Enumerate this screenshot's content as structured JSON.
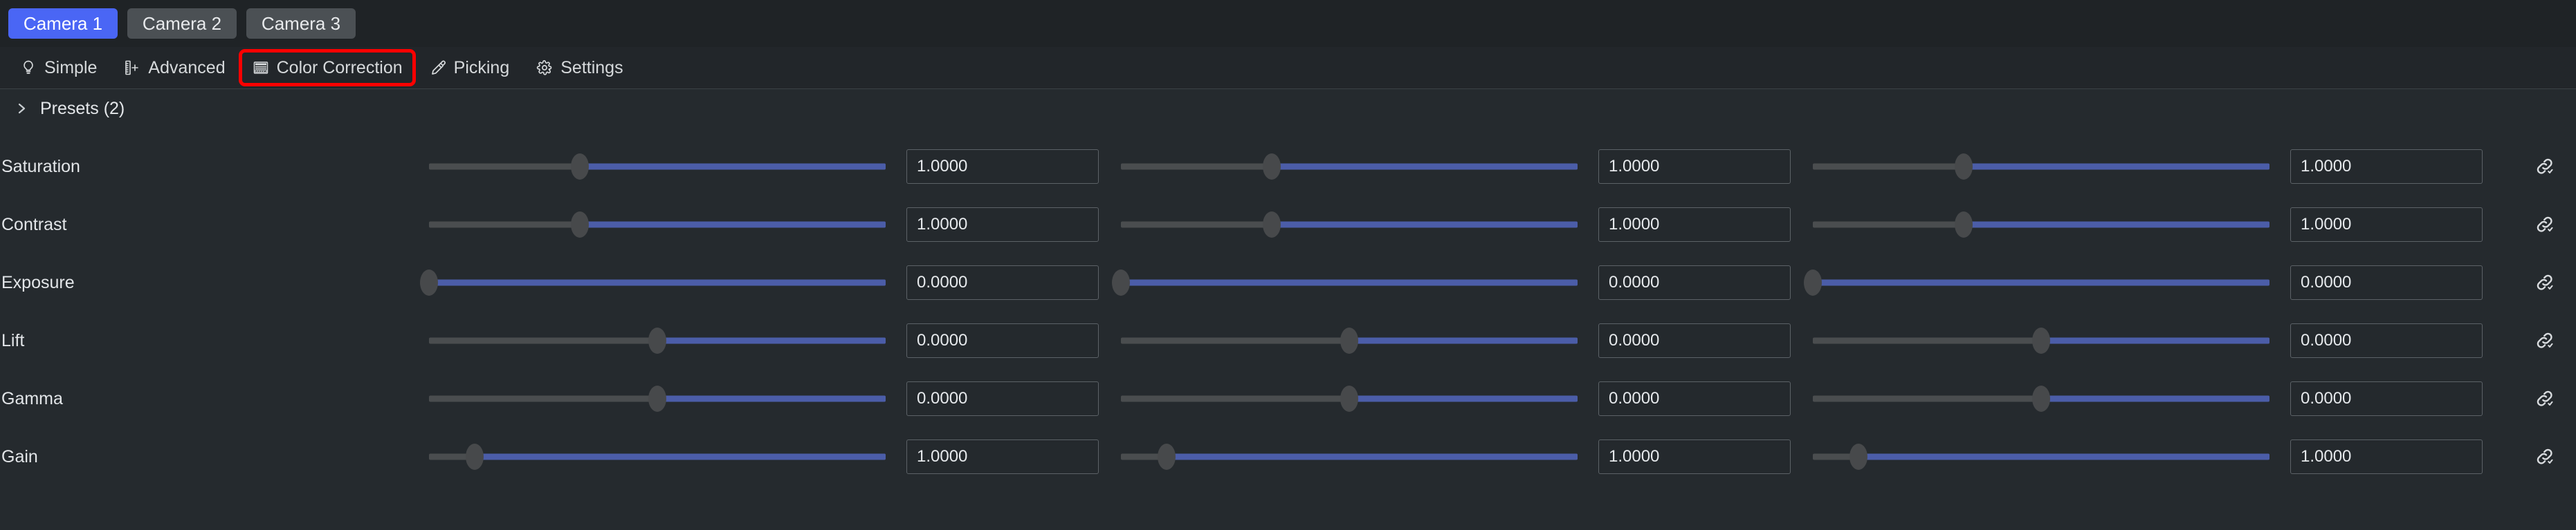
{
  "accent_color": "#4a66f5",
  "highlight_color": "#fd0000",
  "slider_fill_color": "#4b5da8",
  "slider_track_color": "#4a4d4f",
  "background_color": "#252a2e",
  "camera_tabs": [
    {
      "label": "Camera 1",
      "active": true
    },
    {
      "label": "Camera 2",
      "active": false
    },
    {
      "label": "Camera 3",
      "active": false
    }
  ],
  "mode_toolbar": [
    {
      "label": "Simple",
      "icon": "lightbulb-icon",
      "highlighted": false
    },
    {
      "label": "Advanced",
      "icon": "ruler-plus-icon",
      "highlighted": false
    },
    {
      "label": "Color Correction",
      "icon": "color-bars-icon",
      "highlighted": true
    },
    {
      "label": "Picking",
      "icon": "eyedropper-icon",
      "highlighted": false
    },
    {
      "label": "Settings",
      "icon": "gear-icon",
      "highlighted": false
    }
  ],
  "presets": {
    "label": "Presets (2)",
    "count": 2,
    "expanded": false,
    "chevron": "chevron-right-icon"
  },
  "link_icon_name": "link-chain-icon",
  "parameters": [
    {
      "label": "Saturation",
      "channels": [
        {
          "value": "1.0000",
          "thumb_pct": 33
        },
        {
          "value": "1.0000",
          "thumb_pct": 33
        },
        {
          "value": "1.0000",
          "thumb_pct": 33
        }
      ]
    },
    {
      "label": "Contrast",
      "channels": [
        {
          "value": "1.0000",
          "thumb_pct": 33
        },
        {
          "value": "1.0000",
          "thumb_pct": 33
        },
        {
          "value": "1.0000",
          "thumb_pct": 33
        }
      ]
    },
    {
      "label": "Exposure",
      "channels": [
        {
          "value": "0.0000",
          "thumb_pct": 0
        },
        {
          "value": "0.0000",
          "thumb_pct": 0
        },
        {
          "value": "0.0000",
          "thumb_pct": 0
        }
      ]
    },
    {
      "label": "Lift",
      "channels": [
        {
          "value": "0.0000",
          "thumb_pct": 50
        },
        {
          "value": "0.0000",
          "thumb_pct": 50
        },
        {
          "value": "0.0000",
          "thumb_pct": 50
        }
      ]
    },
    {
      "label": "Gamma",
      "channels": [
        {
          "value": "0.0000",
          "thumb_pct": 50
        },
        {
          "value": "0.0000",
          "thumb_pct": 50
        },
        {
          "value": "0.0000",
          "thumb_pct": 50
        }
      ]
    },
    {
      "label": "Gain",
      "channels": [
        {
          "value": "1.0000",
          "thumb_pct": 10
        },
        {
          "value": "1.0000",
          "thumb_pct": 10
        },
        {
          "value": "1.0000",
          "thumb_pct": 10
        }
      ]
    }
  ]
}
